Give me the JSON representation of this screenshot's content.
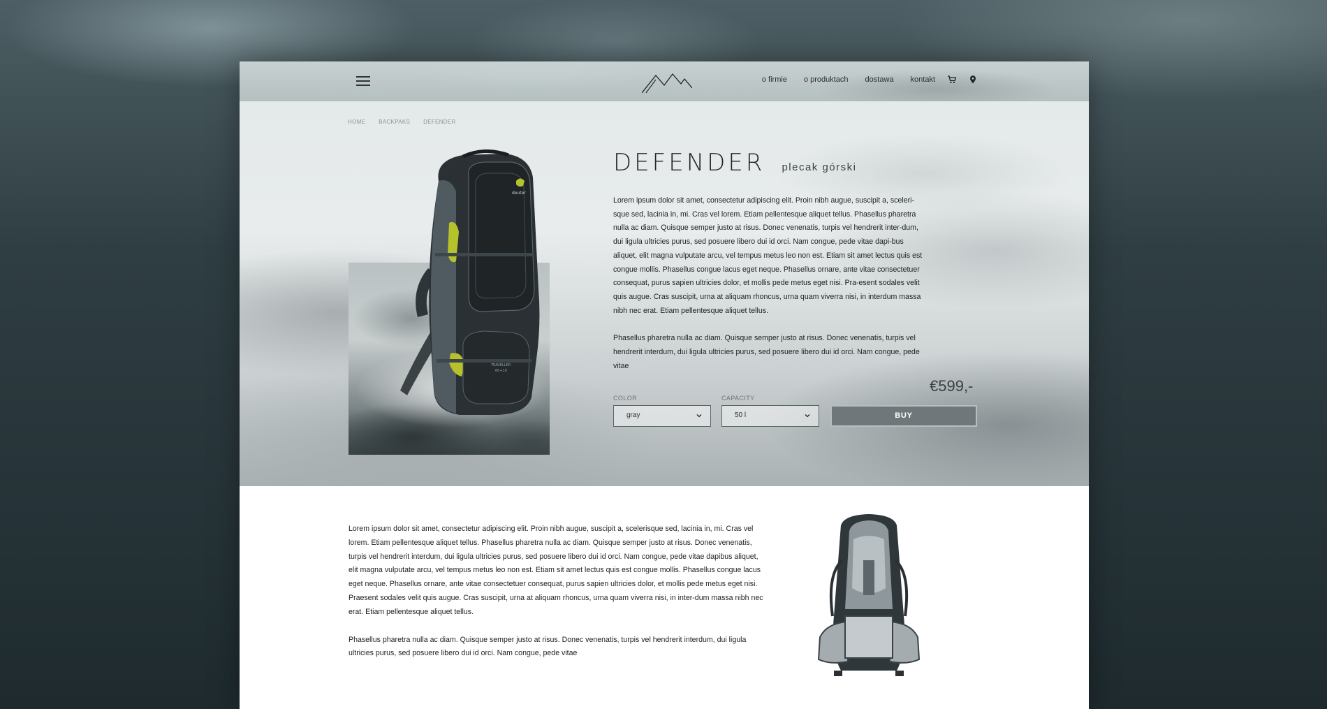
{
  "header": {
    "nav": [
      "o firmie",
      "o produktach",
      "dostawa",
      "kontakt"
    ],
    "icons": [
      "menu-icon",
      "logo-mountains",
      "cart-icon",
      "location-pin-icon"
    ]
  },
  "breadcrumb": [
    "HOME",
    "BACKPAKS",
    "DEFENDER"
  ],
  "product": {
    "name": "DEFENDER",
    "subtitle": "plecak górski",
    "description": [
      "Lorem ipsum dolor sit amet, consectetur adipiscing elit. Proin nibh augue, suscipit a, sceleri-sque sed, lacinia in, mi. Cras vel lorem. Etiam pellentesque aliquet tellus. Phasellus pharetra nulla ac diam. Quisque semper justo at risus. Donec venenatis, turpis vel hendrerit inter-dum, dui ligula ultricies purus, sed posuere libero dui id orci. Nam congue, pede vitae dapi-bus aliquet, elit magna vulputate arcu, vel tempus metus leo non est. Etiam sit amet lectus quis est congue mollis. Phasellus congue lacus eget neque. Phasellus ornare, ante vitae consectetuer consequat, purus sapien ultricies dolor, et mollis pede metus eget nisi. Pra-esent sodales velit quis augue. Cras suscipit, urna at aliquam rhoncus, urna quam viverra nisi, in interdum massa nibh nec erat. Etiam pellentesque aliquet tellus.",
      "Phasellus pharetra nulla ac diam. Quisque semper justo at risus. Donec venenatis, turpis vel hendrerit interdum, dui ligula ultricies purus, sed posuere libero dui id orci. Nam congue, pede vitae"
    ],
    "price": "€599,-",
    "color_label": "COLOR",
    "color_value": "gray",
    "capacity_label": "CAPACITY",
    "capacity_value": "50 l",
    "buy_label": "BUY"
  },
  "details": {
    "paragraphs": [
      "Lorem ipsum dolor sit amet, consectetur adipiscing elit. Proin nibh augue, suscipit a, scelerisque sed, lacinia in, mi. Cras vel lorem. Etiam pellentesque aliquet tellus. Phasellus pharetra nulla ac diam. Quisque semper justo at risus. Donec venenatis, turpis vel hendrerit interdum, dui ligula ultricies purus, sed posuere libero dui id orci. Nam congue, pede vitae dapibus aliquet, elit magna vulputate arcu, vel tempus metus leo non est. Etiam sit amet lectus quis est congue mollis. Phasellus congue lacus eget neque. Phasellus ornare, ante vitae consectetuer consequat, purus sapien ultricies dolor, et mollis pede metus eget nisi. Praesent sodales velit quis augue. Cras suscipit, urna at aliquam rhoncus, urna quam viverra nisi, in inter-dum massa nibh nec erat. Etiam pellentesque aliquet tellus.",
      "Phasellus pharetra nulla ac diam. Quisque semper justo at risus. Donec venenatis, turpis vel hendrerit interdum, dui ligula ultricies purus, sed posuere libero dui id orci. Nam congue, pede vitae"
    ]
  },
  "colors": {
    "accent_gray": "#6f777a",
    "pack_lime": "#b5c22c",
    "pack_dark": "#2b3236"
  }
}
